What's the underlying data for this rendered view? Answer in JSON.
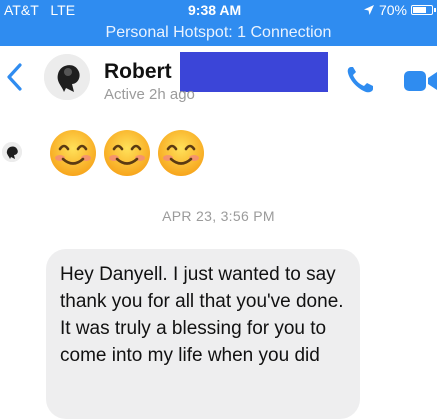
{
  "status_bar": {
    "carrier": "AT&T",
    "network": "LTE",
    "time": "9:38 AM",
    "battery": "70%",
    "battery_level": 0.7
  },
  "hotspot": {
    "text": "Personal Hotspot: 1 Connection"
  },
  "header": {
    "name": "Robert",
    "status": "Active 2h ago"
  },
  "conversation": {
    "emojis": [
      "😊",
      "😊",
      "😊"
    ],
    "timestamp": "APR 23, 3:56 PM",
    "message": "Hey Danyell. I just wanted to say thank you for all that you've done. It was truly a blessing for you to come into my life when you did"
  },
  "colors": {
    "accent": "#2f8cf0",
    "redaction": "#3b45d8",
    "bubble": "#eeeeef"
  }
}
